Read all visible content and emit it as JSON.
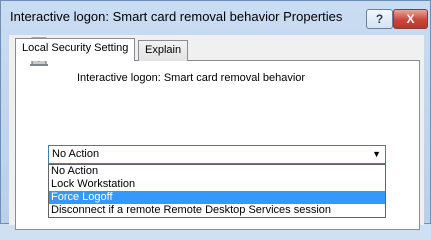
{
  "window": {
    "title": "Interactive logon: Smart card removal behavior Properties",
    "help_label": "?",
    "close_label": "X"
  },
  "tabs": [
    {
      "label": "Local Security Setting",
      "active": true
    },
    {
      "label": "Explain",
      "active": false
    }
  ],
  "policy": {
    "name": "Interactive logon: Smart card removal behavior",
    "icon": "server-icon"
  },
  "combo": {
    "selected": "No Action",
    "arrow": "▼"
  },
  "dropdown": {
    "options": [
      {
        "label": "No Action",
        "highlighted": false
      },
      {
        "label": "Lock Workstation",
        "highlighted": false
      },
      {
        "label": "Force Logoff",
        "highlighted": true
      },
      {
        "label": "Disconnect if a remote Remote Desktop Services session",
        "highlighted": false
      }
    ]
  },
  "colors": {
    "highlight": "#3399ff",
    "close_button": "#c9463a"
  }
}
